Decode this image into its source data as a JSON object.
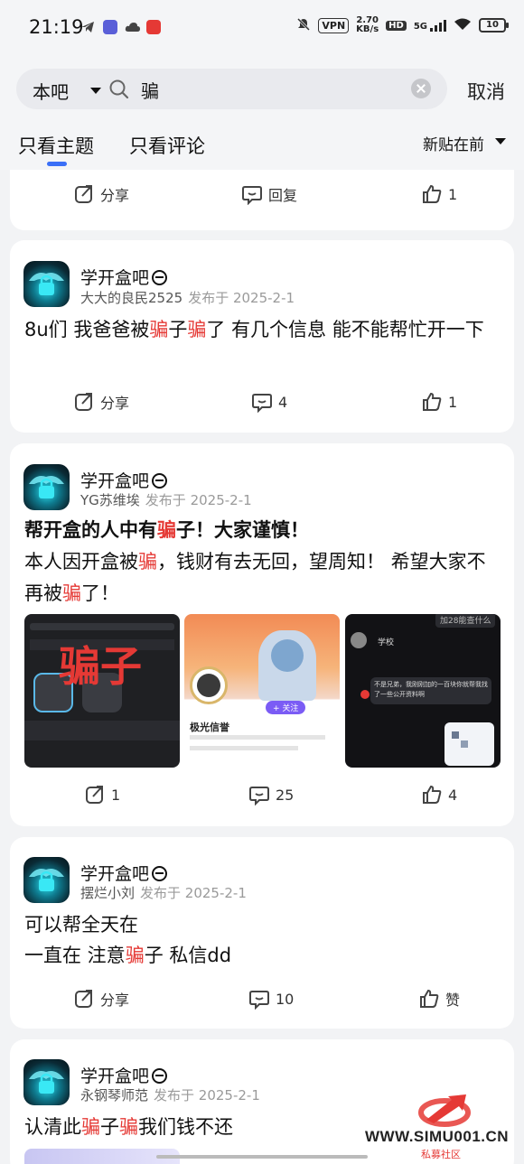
{
  "status_bar": {
    "time": "21:19",
    "vpn": "VPN",
    "rate_value": "2.70",
    "rate_unit": "KB/s",
    "hd": "HD",
    "network": "5G",
    "battery": "10"
  },
  "search": {
    "scope": "本吧",
    "query": "骗",
    "cancel_label": "取消"
  },
  "tabs": [
    {
      "label": "只看主题",
      "active": true
    },
    {
      "label": "只看评论",
      "active": false
    }
  ],
  "sort_label": "新贴在前",
  "top_card_actions": {
    "share": "分享",
    "reply": "回复",
    "like": "1"
  },
  "posts": [
    {
      "forum": "学开盒吧",
      "author": "大大的良民2525",
      "published": "发布于 2025-2-1",
      "text": [
        [
          "8u们 我爸爸被",
          "骗",
          "子",
          "骗",
          "了 有几个信息 能不能帮忙开一下"
        ]
      ],
      "actions": {
        "share": "分享",
        "comments": "4",
        "likes": "1"
      }
    },
    {
      "forum": "学开盒吧",
      "author": "YG苏维埃",
      "published": "发布于 2025-2-1",
      "text_line1_a": "帮开盒的人中有",
      "text_line1_hl": "骗",
      "text_line1_b": "子！大家谨慎！",
      "text_line2_a": "本人因开盒被",
      "text_line2_hl": "骗",
      "text_line2_b": "，钱财有去无回，望周知！ 希望大家不再被",
      "text_line2_hl2": "骗",
      "text_line2_c": "了！",
      "image1_overlay": "骗子",
      "image2_name": "极光信誉",
      "image2_follow": "+ 关注",
      "image3_title": "学校",
      "image3_top": "加28能查什么",
      "image3_msg": "不是兄弟，我刚刚加的一百块你就帮我找了一些公开资料啊",
      "actions": {
        "share": "1",
        "comments": "25",
        "likes": "4"
      }
    },
    {
      "forum": "学开盒吧",
      "author": "摆烂小刘",
      "published": "发布于 2025-2-1",
      "line1": "可以帮全天在",
      "line2_a": "一直在 注意",
      "line2_hl": "骗",
      "line2_b": "子 私信dd",
      "actions": {
        "share": "分享",
        "comments": "10",
        "likes": "赞"
      }
    },
    {
      "forum": "学开盒吧",
      "author": "永钢琴师范",
      "published": "发布于 2025-2-1",
      "text_a": "认清此",
      "text_hl1": "骗",
      "text_b": "子",
      "text_hl2": "骗",
      "text_c": "我们钱不还"
    }
  ],
  "watermark": {
    "site": "WWW.SIMU001.CN",
    "label": "私募社区"
  },
  "colors": {
    "highlight": "#e53935",
    "tab_indicator": "#3a6ff7"
  }
}
